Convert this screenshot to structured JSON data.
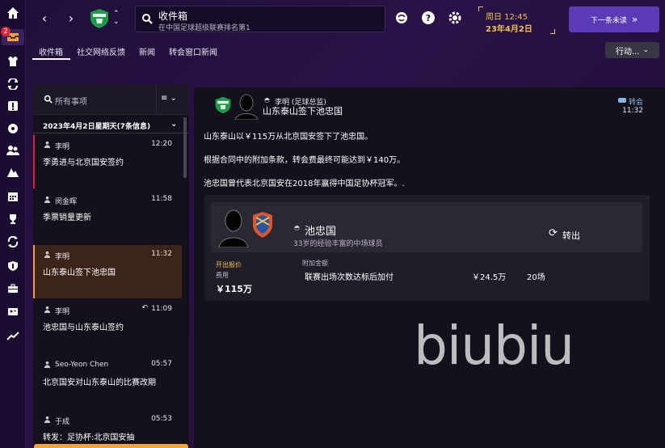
{
  "rail": {
    "items": [
      "home-icon",
      "inbox-icon",
      "squad-icon",
      "tactics-icon",
      "injury-icon",
      "match-icon",
      "staff-icon",
      "training-icon",
      "calendar-icon",
      "trophy-icon",
      "transfers-icon",
      "club-icon",
      "finances-icon",
      "scouting-icon",
      "stats-icon"
    ],
    "inbox_badge": "2"
  },
  "topbar": {
    "title": "收件箱",
    "subtitle": "在中国足球超级联赛排名第1",
    "time": "周日 12:45",
    "date": "23年4月2日",
    "continue_label": "下一条未读"
  },
  "tabs": [
    "收件箱",
    "社交网络反馈",
    "新闻",
    "转会窗口新闻"
  ],
  "actions_label": "行动...",
  "list": {
    "search_placeholder": "所有事项",
    "date_header": "2023年4月2日星期天(7条信息)",
    "messages": [
      {
        "from": "李明",
        "time": "12:20",
        "subject": "李勇进与北京国安签约"
      },
      {
        "from": "闵金晖",
        "time": "11:58",
        "subject": "季票销量更新"
      },
      {
        "from": "李明",
        "time": "11:32",
        "subject": "山东泰山签下池忠国"
      },
      {
        "from": "李明",
        "time": "11:09",
        "subject": "池忠国与山东泰山签约"
      },
      {
        "from": "Seo-Yeon Chen",
        "time": "05:57",
        "subject": "北京国安对山东泰山的比赛改期"
      },
      {
        "from": "于成",
        "time": "05:53",
        "subject": "转发：足协杯:北京国安抽"
      }
    ]
  },
  "detail": {
    "sender": "李明 (足球总监)",
    "title": "山东泰山签下池忠国",
    "category": "转会",
    "time": "11:32",
    "paragraphs": [
      "山东泰山以￥115万从北京国安签下了池忠国。",
      "根据合同中的附加条款，转会费最终可能达到￥140万。",
      "池忠国曾代表北京国安在2018年赢得中国足协杯冠军。."
    ],
    "player_name": "池忠国",
    "player_desc": "33岁的经验丰富的中场球员",
    "status": "转出",
    "offer_label": "开出报价",
    "fee_label": "费用",
    "fee": "￥115万",
    "addon_label": "附加金额",
    "addon_desc": "联赛出场次数达标后加付",
    "addon_amount": "￥24.5万",
    "addon_count": "20场"
  },
  "watermark": "biubiu",
  "colors": {
    "accent": "#5b3ab5",
    "date": "#f2c14e",
    "selected": "#3c2518",
    "orange": "#f2a33a"
  }
}
